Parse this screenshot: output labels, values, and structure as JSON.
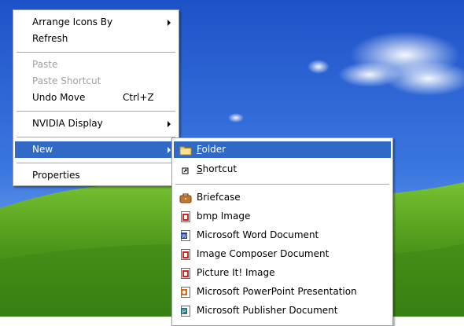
{
  "context_menu": {
    "items": {
      "arrange": "Arrange Icons By",
      "refresh": "Refresh",
      "paste": "Paste",
      "paste_shortcut": "Paste Shortcut",
      "undo_move": "Undo Move",
      "undo_shortcut": "Ctrl+Z",
      "nvidia": "NVIDIA Display",
      "new": "New",
      "properties": "Properties"
    }
  },
  "new_submenu": {
    "folder_mnemonic": "F",
    "folder_rest": "older",
    "shortcut_mnemonic": "S",
    "shortcut_rest": "hortcut",
    "briefcase": "Briefcase",
    "bmp": "bmp Image",
    "word": "Microsoft Word Document",
    "image_composer": "Image Composer Document",
    "picture_it": "Picture It! Image",
    "powerpoint": "Microsoft PowerPoint Presentation",
    "publisher": "Microsoft Publisher Document"
  },
  "icons": {
    "folder": "folder-icon",
    "shortcut": "shortcut-icon",
    "briefcase": "briefcase-icon",
    "bmp": "bmp-image-icon",
    "word": "word-document-icon",
    "image_composer": "image-composer-icon",
    "picture_it": "picture-it-icon",
    "powerpoint": "powerpoint-icon",
    "publisher": "publisher-icon"
  },
  "colors": {
    "highlight": "#316ac5",
    "sky": "#2f63d8",
    "hill": "#4f9a1c",
    "disabled_text": "#a0a0a0"
  }
}
